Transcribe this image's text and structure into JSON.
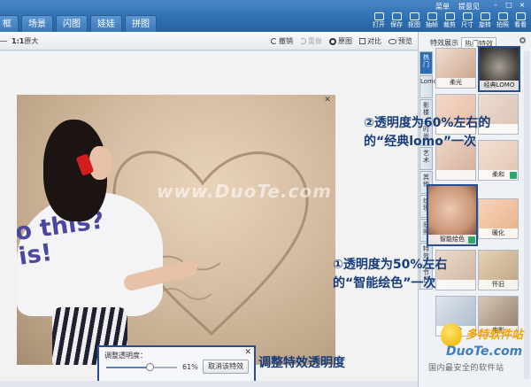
{
  "tabs": [
    "框",
    "场景",
    "闪图",
    "娃娃",
    "拼图"
  ],
  "menu_links": [
    "菜单",
    "提意见"
  ],
  "window_buttons": [
    "–",
    "□",
    "×"
  ],
  "tools": [
    {
      "label": "打开",
      "icon": "folder-icon"
    },
    {
      "label": "保存",
      "icon": "save-icon"
    },
    {
      "label": "抠图",
      "icon": "cutout-icon"
    },
    {
      "label": "抽帧",
      "icon": "frame-icon"
    },
    {
      "label": "裁剪",
      "icon": "crop-icon"
    },
    {
      "label": "尺寸",
      "icon": "resize-icon"
    },
    {
      "label": "旋转",
      "icon": "rotate-icon"
    },
    {
      "label": "拍照",
      "icon": "camera-icon"
    },
    {
      "label": "看看",
      "icon": "view-icon"
    }
  ],
  "zoom": {
    "ratio": "1:1",
    "label": "原大"
  },
  "actions": {
    "undo": "撤销",
    "redo": "重做",
    "original": "原图",
    "compare": "对比",
    "preview": "预览"
  },
  "panel": {
    "tab_effects": "特效展示",
    "tab_hot": "热门特效"
  },
  "side_tabs": [
    "热门",
    "Lomo",
    "影楼",
    "时尚",
    "艺术",
    "其他",
    "纹理",
    "旧照",
    "特效",
    "节日"
  ],
  "thumbnails": [
    {
      "label": "柔光"
    },
    {
      "label": "经典LOMO"
    },
    {
      "label": ""
    },
    {
      "label": ""
    },
    {
      "label": ""
    },
    {
      "label": "柔和"
    },
    {
      "label": "智能绘色"
    },
    {
      "label": "暖化"
    },
    {
      "label": ""
    },
    {
      "label": "怀旧"
    },
    {
      "label": "冰冷"
    },
    {
      "label": "电影"
    }
  ],
  "photo": {
    "shirt_text": "o this?\nis!",
    "watermark": "www.DuoTe.com"
  },
  "adjust": {
    "title": "调整透明度：",
    "value": 0.61,
    "value_label": "61%",
    "cancel": "取消该特效",
    "caption": "调整特效透明度"
  },
  "notes": {
    "lomo_line1": "②透明度为60%左右的",
    "lomo_line2": "的“经典lomo”一次",
    "color_line1": "①透明度为50%左右",
    "color_line2": "的“智能绘色”一次"
  },
  "logo": {
    "site": "多特软件站",
    "domain": "DuoTe.com",
    "slogan": "国内最安全的软件站"
  }
}
